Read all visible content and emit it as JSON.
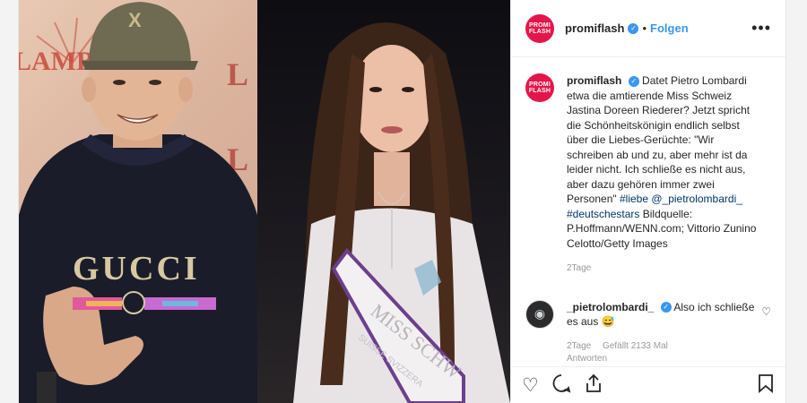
{
  "post": {
    "username": "promiflash",
    "follow_label": "Folgen",
    "more_label": "•••",
    "dot": "•",
    "avatar_line1": "PROMI",
    "avatar_line2": "FLASH",
    "caption_text": "Datet Pietro Lombardi etwa die amtierende Miss Schweiz Jastina Doreen Riederer? Jetzt spricht die Schönheitskönigin endlich selbst über die Liebes-Gerüchte: \"Wir schreiben ab und zu, aber mehr ist da leider nicht. Ich schließe es nicht aus, aber dazu gehören immer zwei Personen\"",
    "caption_tags": "#liebe @_pietrolombardi_ #deutschestars",
    "caption_source": "Bildquelle: P.Hoffmann/WENN.com; Vittorio Zunino Celotto/Getty Images",
    "timestamp": "2Tage"
  },
  "comment": {
    "username": "_pietrolombardi_",
    "text": "Also ich schließe es aus 😅",
    "time": "2Tage",
    "likes": "Gefällt 2133 Mal",
    "reply_label": "Antworten"
  },
  "photos": {
    "left_shirt_text": "GUCCI",
    "left_backdrop_text": "LAMB",
    "right_sash_text_1": "MISS SCHW",
    "right_sash_text_2": "SUISSE SVIZZERA"
  },
  "colors": {
    "brand": "#e4154a",
    "link": "#3897f0",
    "text": "#262626",
    "muted": "#999999"
  }
}
